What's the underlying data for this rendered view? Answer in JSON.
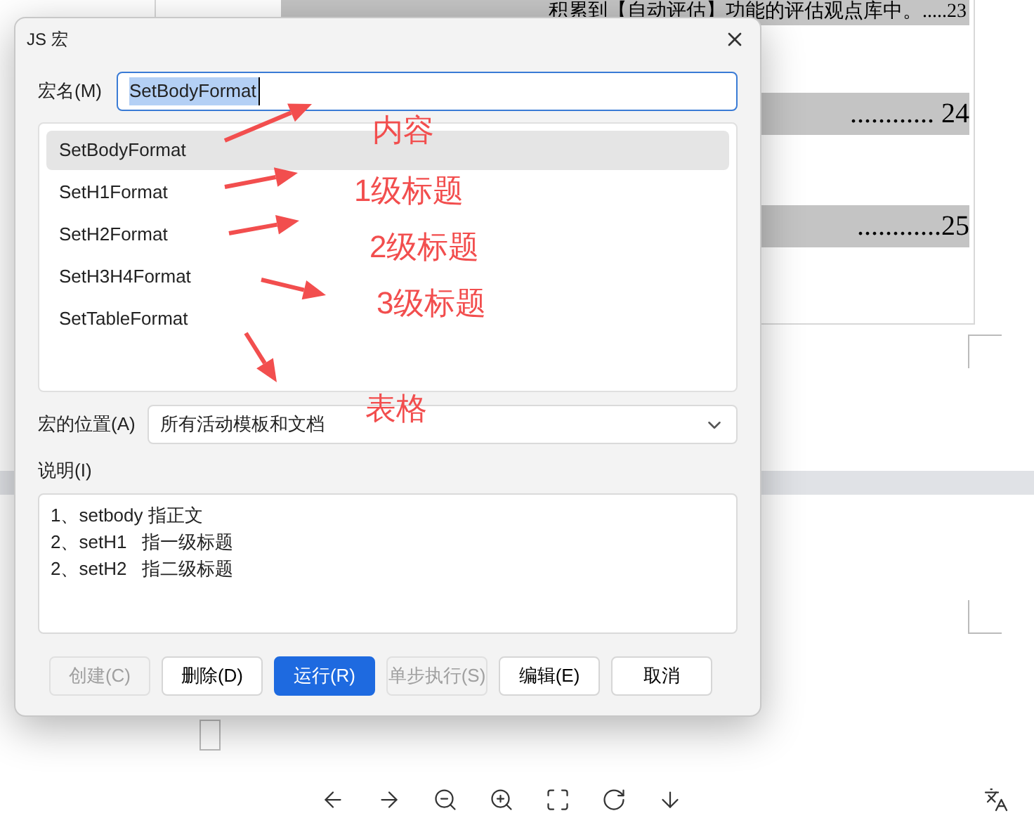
{
  "document": {
    "toc_lines": [
      {
        "text": "积累到【自动评估】功能的评估观点库中。.....23"
      },
      {
        "text": "............ 24"
      },
      {
        "text": "............25"
      }
    ]
  },
  "dialog": {
    "title": "JS 宏",
    "name_label": "宏名(M)",
    "name_value": "SetBodyFormat",
    "macros": [
      {
        "name": "SetBodyFormat",
        "selected": true
      },
      {
        "name": "SetH1Format",
        "selected": false
      },
      {
        "name": "SetH2Format",
        "selected": false
      },
      {
        "name": "SetH3H4Format",
        "selected": false
      },
      {
        "name": "SetTableFormat",
        "selected": false
      }
    ],
    "location_label": "宏的位置(A)",
    "location_value": "所有活动模板和文档",
    "description_label": "说明(I)",
    "description_lines": [
      "1、setbody 指正文",
      "2、setH1   指一级标题",
      "2、setH2   指二级标题"
    ],
    "buttons": [
      {
        "label": "创建(C)",
        "kind": "normal",
        "disabled": true
      },
      {
        "label": "删除(D)",
        "kind": "normal",
        "disabled": false
      },
      {
        "label": "运行(R)",
        "kind": "primary",
        "disabled": false
      },
      {
        "label": "单步执行(S)",
        "kind": "normal",
        "disabled": true
      },
      {
        "label": "编辑(E)",
        "kind": "normal",
        "disabled": false
      },
      {
        "label": "取消",
        "kind": "normal",
        "disabled": false
      }
    ]
  },
  "annotations": [
    {
      "label": "内容"
    },
    {
      "label": "1级标题"
    },
    {
      "label": "2级标题"
    },
    {
      "label": "3级标题"
    },
    {
      "label": "表格"
    }
  ]
}
